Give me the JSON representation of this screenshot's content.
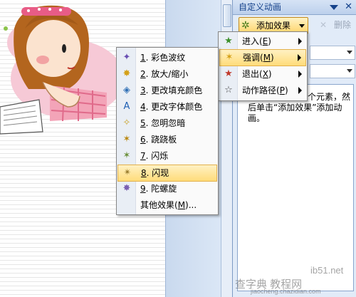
{
  "task_pane": {
    "title": "自定义动画",
    "add_effect_label": "添加效果",
    "delete_label": "删除",
    "hint": "选中幻灯片的某个元素，然后单击“添加效果”添加动画。"
  },
  "effect_menu": {
    "items": [
      {
        "icon": "enter-icon",
        "label": "进入(",
        "key": "E",
        "suffix": ")"
      },
      {
        "icon": "emphasis-icon",
        "label": "强调(",
        "key": "M",
        "suffix": ")"
      },
      {
        "icon": "exit-icon",
        "label": "退出(",
        "key": "X",
        "suffix": ")"
      },
      {
        "icon": "motion-path-icon",
        "label": "动作路径(",
        "key": "P",
        "suffix": ")"
      }
    ],
    "highlighted_index": 1
  },
  "emphasis_menu": {
    "items": [
      {
        "num": "1",
        "label": ". 彩色波纹"
      },
      {
        "num": "2",
        "label": ". 放大/缩小"
      },
      {
        "num": "3",
        "label": ". 更改填充颜色"
      },
      {
        "num": "4",
        "label": ". 更改字体颜色"
      },
      {
        "num": "5",
        "label": ". 忽明忽暗"
      },
      {
        "num": "6",
        "label": ". 跷跷板"
      },
      {
        "num": "7",
        "label": ". 闪烁"
      },
      {
        "num": "8",
        "label": ". 闪现"
      },
      {
        "num": "9",
        "label": ". 陀螺旋"
      }
    ],
    "more_label": "其他效果(",
    "more_key": "M",
    "more_suffix": ")...",
    "highlighted_index": 7
  },
  "watermarks": {
    "site": "ib51.net",
    "brand": "查字典 教程网",
    "url": "jiaocheng.chazidian.com"
  }
}
